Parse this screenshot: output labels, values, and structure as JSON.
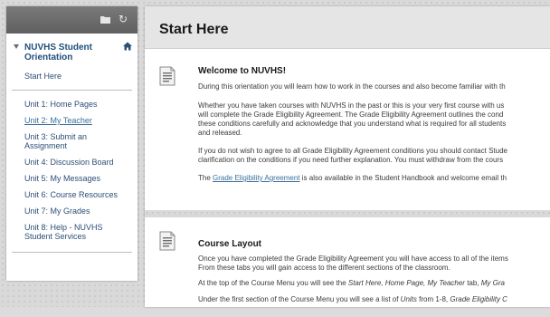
{
  "sidebar": {
    "course_title": "NUVHS Student Orientation",
    "start_here": "Start Here",
    "items": [
      {
        "label": "Unit 1: Home Pages"
      },
      {
        "label": "Unit 2: My Teacher"
      },
      {
        "label": "Unit 3: Submit an Assignment"
      },
      {
        "label": "Unit 4: Discussion Board"
      },
      {
        "label": "Unit 5: My Messages"
      },
      {
        "label": "Unit 6: Course Resources"
      },
      {
        "label": "Unit 7: My Grades"
      },
      {
        "label": "Unit 8: Help - NUVHS Student Services"
      }
    ],
    "tools": {
      "folder_icon": "folder-icon",
      "refresh_icon": "refresh-icon"
    }
  },
  "page": {
    "title": "Start Here"
  },
  "items": [
    {
      "title": "Welcome to NUVHS!",
      "p1": "During this orientation you will learn how to work in the courses and also become familiar with th",
      "p2_l1": "Whether you have taken courses with NUVHS in the past or this is your very first course with us",
      "p2_l2": "will complete the Grade Eligibility Agreement.  The Grade Eligibility Agreement outlines the cond",
      "p2_l3": "these conditions carefully and acknowledge that you understand what is required for all students",
      "p2_l4": "and released.",
      "p3_l1": "If you do not wish to agree to all Grade Eligibility Agreement conditions you should contact Stude",
      "p3_l2": "clarification on the conditions if you need further explanation.  You must withdraw from the cours",
      "p4_pre": "The ",
      "p4_link": "Grade Eligibility Agreement",
      "p4_post": " is also available in the Student Handbook and welcome email th"
    },
    {
      "title": "Course Layout",
      "p1_l1": "Once you have completed the Grade Eligibility Agreement you will have access to all of the items",
      "p1_l2": "From these tabs you will gain access to the different sections of the classroom.",
      "p2_pre": "At the top of the Course Menu you will see the ",
      "p2_em": "Start Here, Home Page, My Teacher",
      "p2_mid": " tab, ",
      "p2_em2": "My Gra",
      "p3_pre": "Under the first section of the Course Menu you will see a list of ",
      "p3_em": "Units",
      "p3_mid": " from 1-8, ",
      "p3_em2": "Grade Eligibility C"
    }
  ]
}
